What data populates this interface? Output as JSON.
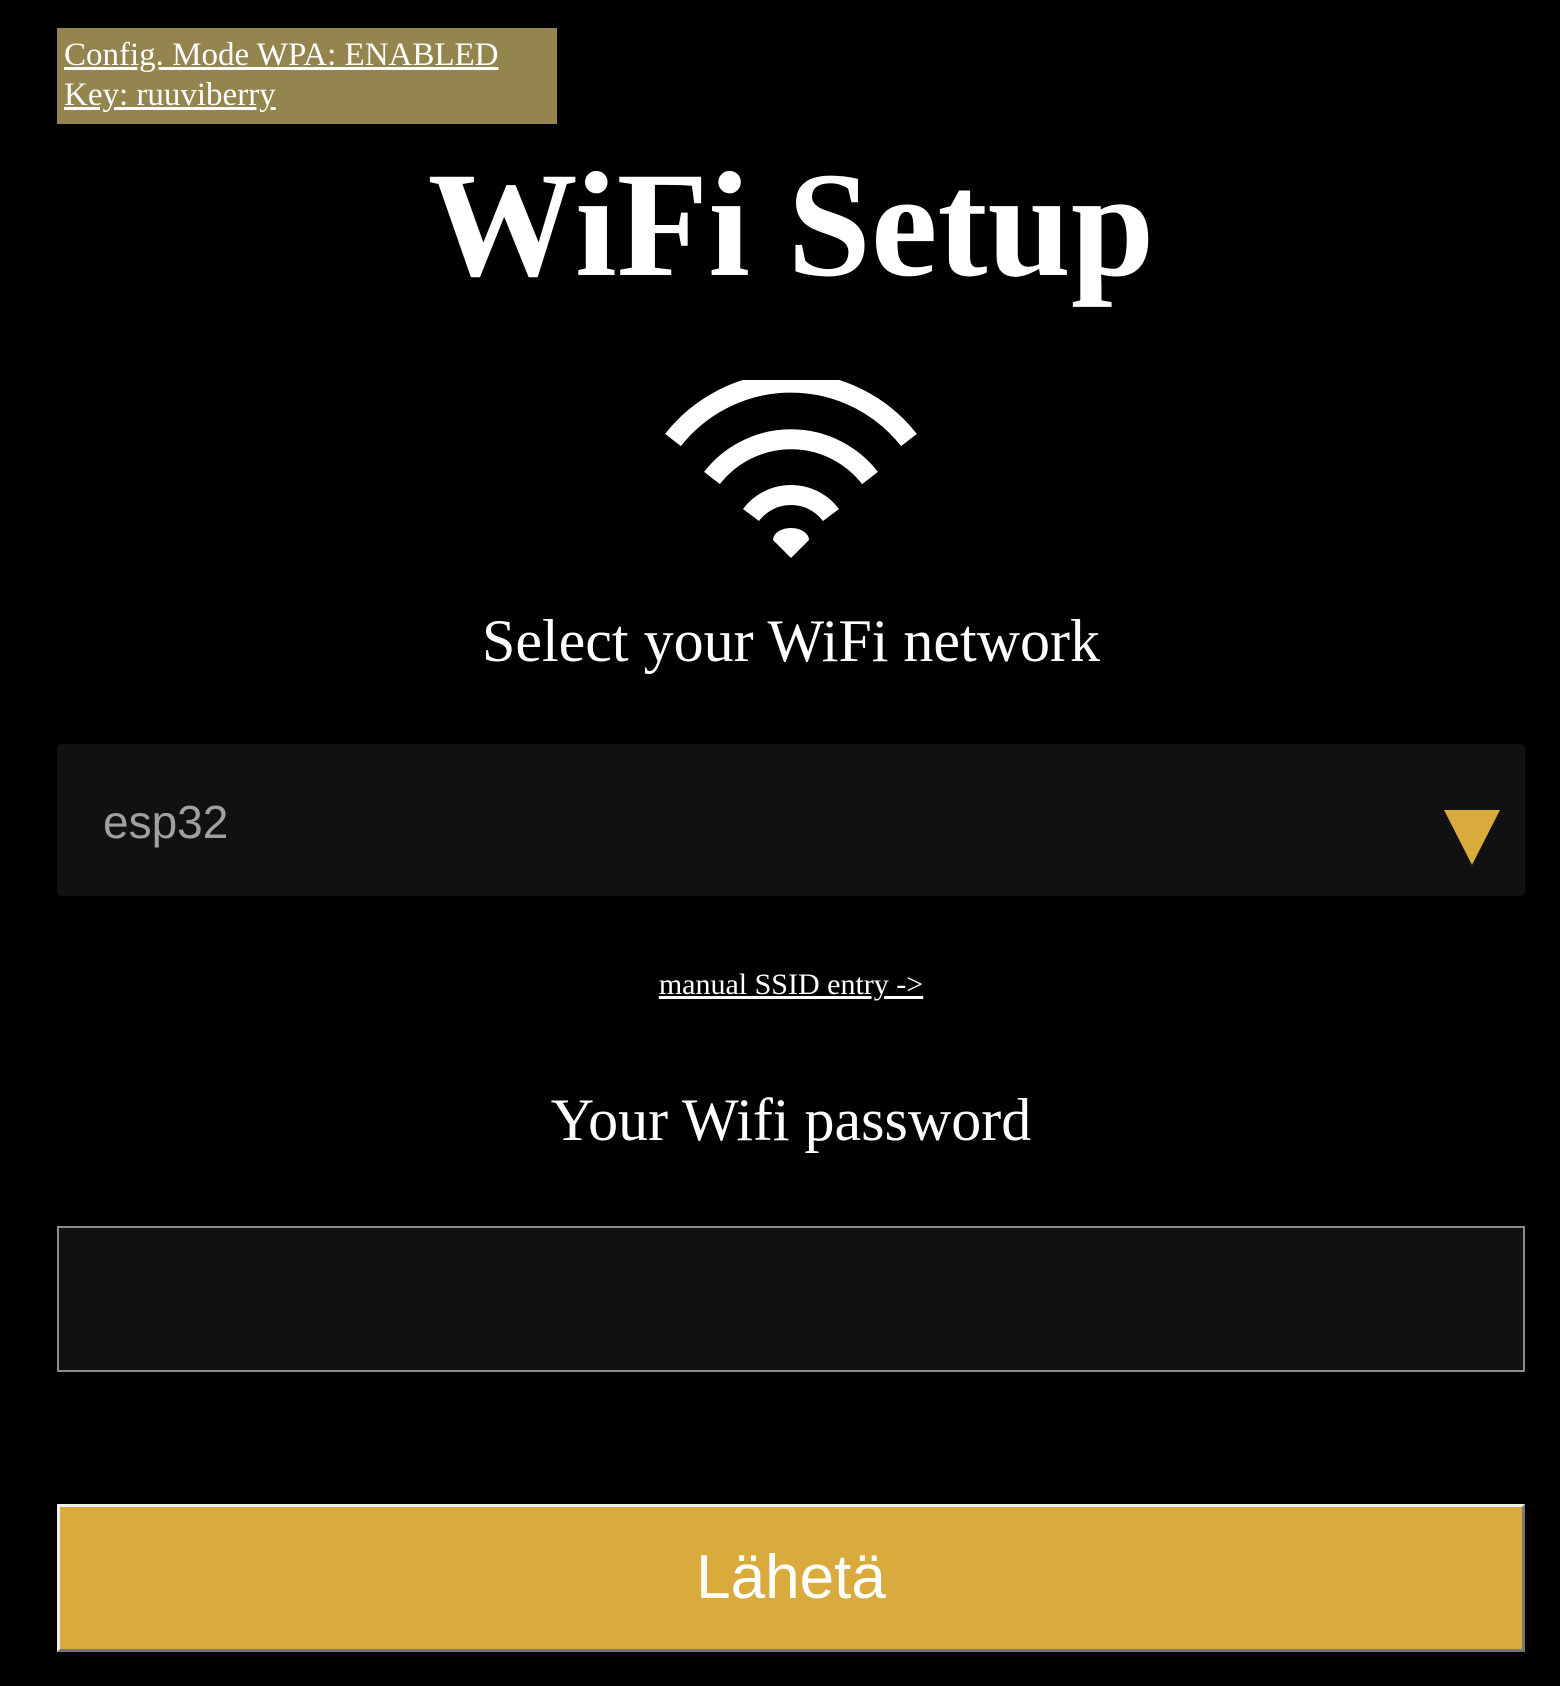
{
  "config_banner": {
    "line1": "Config. Mode WPA: ENABLED",
    "line2": "Key: ruuviberry",
    "background_color": "#94844d"
  },
  "header": {
    "title": "WiFi Setup",
    "icon": "wifi-icon"
  },
  "network": {
    "label": "Select your WiFi network",
    "selected_value": "esp32",
    "dropdown_icon": "triangle-down-icon",
    "accent_color": "#d8ab3c"
  },
  "manual_entry": {
    "link_text": "manual SSID entry ->"
  },
  "password": {
    "label": "Your Wifi password",
    "value": "",
    "placeholder": ""
  },
  "submit": {
    "label": "Lähetä",
    "color": "#d8ab3c"
  }
}
